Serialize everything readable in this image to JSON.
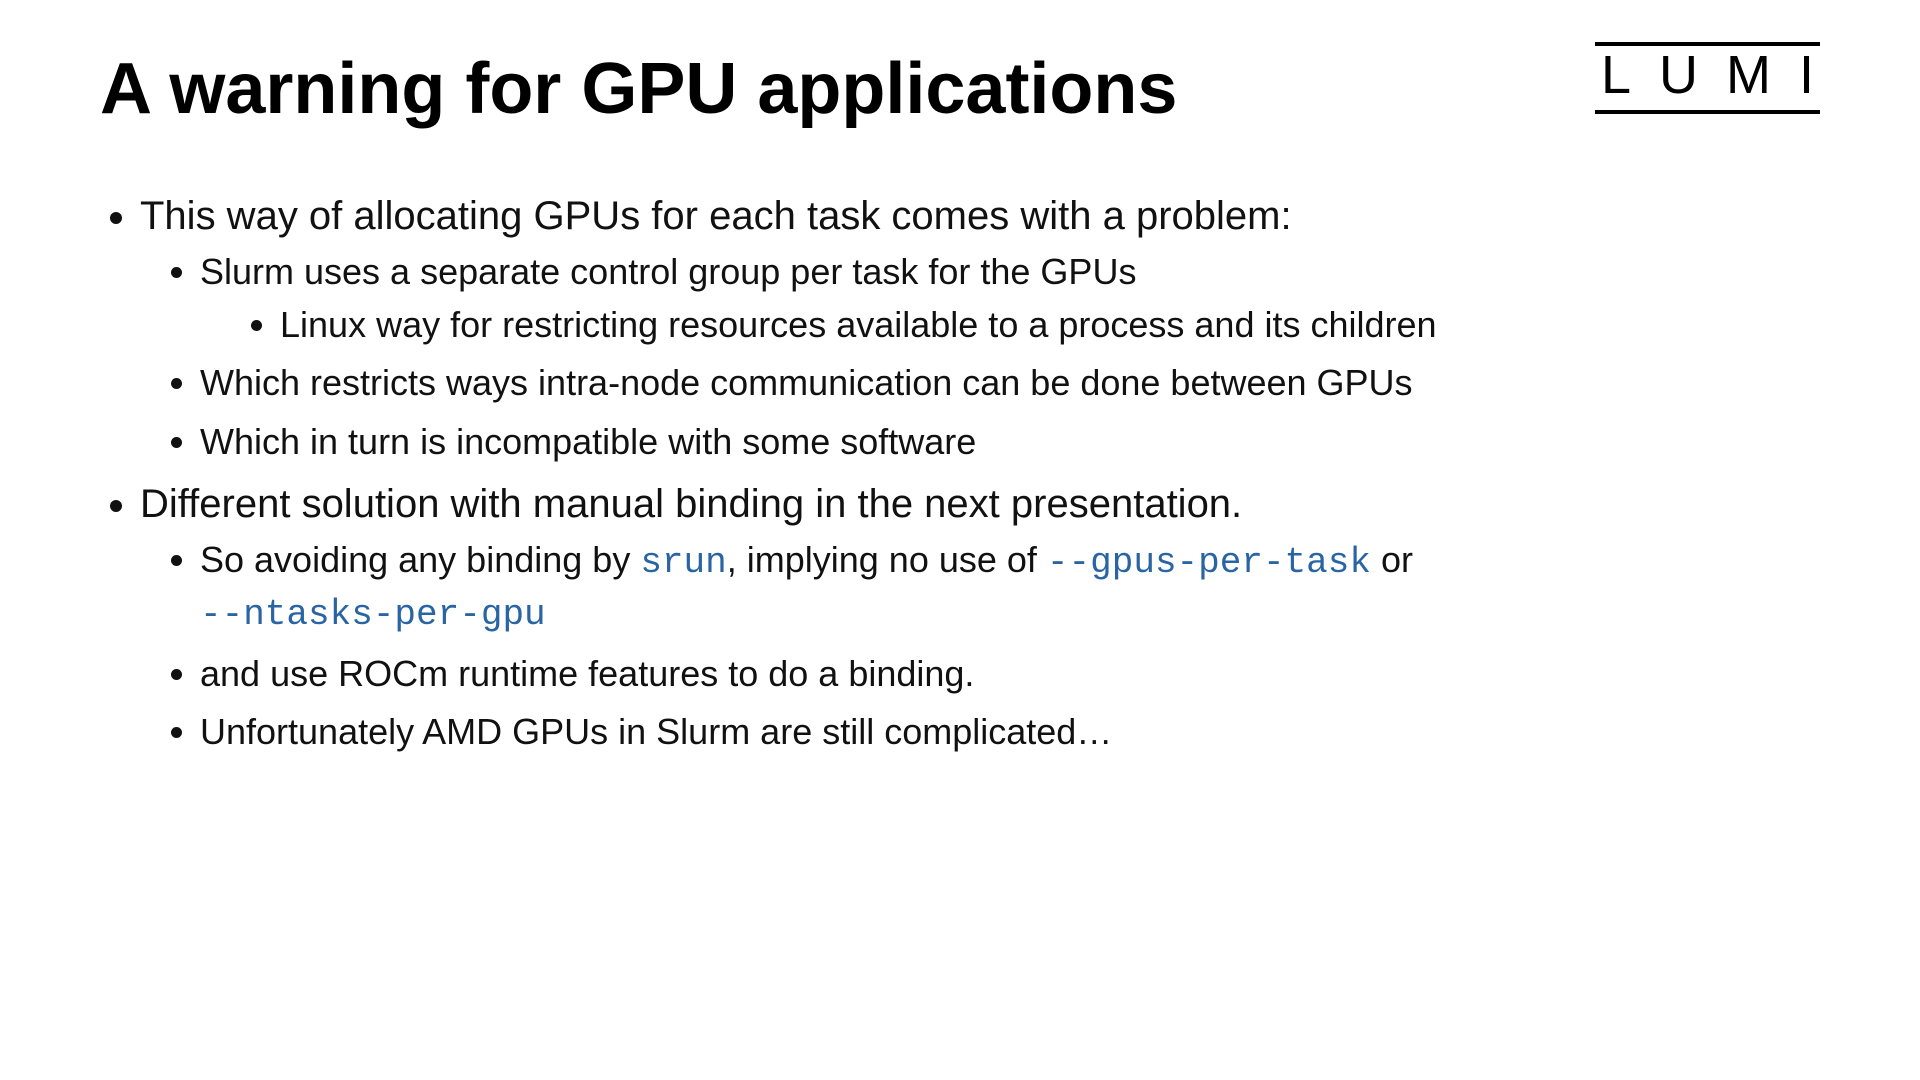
{
  "logo": "LUMI",
  "title": "A warning for GPU applications",
  "bullets": {
    "b1": "This way of allocating GPUs for each task comes with a problem:",
    "b1_1": "Slurm uses a separate control group per task for the GPUs",
    "b1_1_1": "Linux way for restricting resources available to a process and its children",
    "b1_2": "Which restricts ways intra-node communication can be done between GPUs",
    "b1_3": "Which in turn is incompatible with some software",
    "b2": "Different solution with manual binding in the next presentation.",
    "b2_1_a": "So avoiding any binding by ",
    "b2_1_code1": "srun",
    "b2_1_b": ", implying no use of ",
    "b2_1_code2": "--gpus-per-task",
    "b2_1_c": " or ",
    "b2_1_code3": "--ntasks-per-gpu",
    "b2_2": "and use ROCm runtime features to do a binding.",
    "b2_3": "Unfortunately AMD GPUs in Slurm are still complicated…"
  }
}
